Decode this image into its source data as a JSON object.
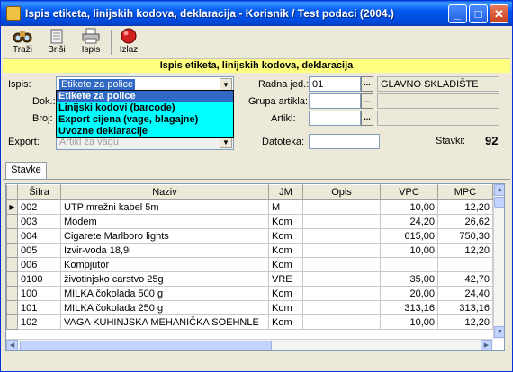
{
  "window": {
    "title": "Ispis etiketa, linijskih kodova, deklaracija - Korisnik / Test podaci (2004.)",
    "minimize_glyph": "_",
    "maximize_glyph": "□",
    "close_glyph": "✕"
  },
  "toolbar": {
    "items": [
      {
        "label": "Traži",
        "icon": "search-binoculars-icon"
      },
      {
        "label": "Briši",
        "icon": "delete-icon"
      },
      {
        "label": "Ispis",
        "icon": "printer-icon"
      },
      {
        "label": "Izlaz",
        "icon": "exit-icon"
      }
    ]
  },
  "banner": "Ispis etiketa, linijskih kodova, deklaracija",
  "form": {
    "ispis_label": "Ispis:",
    "ispis_value": "Etikete za police",
    "dok_label": "Dok.:",
    "broj_label": "Broj:",
    "export_label": "Export:",
    "export_value": "Artikl za vagu",
    "radna_label": "Radna jed.:",
    "radna_value": "01",
    "radna_name": "GLAVNO SKLADIŠTE",
    "grupa_label": "Grupa artikla:",
    "artikl_label": "Artikl:",
    "datoteka_label": "Datoteka:",
    "stavki_label": "Stavki:",
    "stavki_value": "92",
    "ellipsis": "..."
  },
  "dropdown": {
    "options": [
      "Etikete za police",
      "Linijski kodovi (barcode)",
      "Export cijena (vage, blagajne)",
      "Uvozne deklaracije"
    ],
    "selected_index": 0
  },
  "tabs": [
    {
      "label": "Stavke"
    }
  ],
  "grid": {
    "columns": [
      "Šifra",
      "Naziv",
      "JM",
      "Opis",
      "VPC",
      "MPC"
    ],
    "current_row_marker": "▶",
    "rows": [
      [
        "002",
        "UTP mrežni kabel 5m",
        "M",
        "",
        "10,00",
        "12,20"
      ],
      [
        "003",
        "Modem",
        "Kom",
        "",
        "24,20",
        "26,62"
      ],
      [
        "004",
        "Cigarete Marlboro lights",
        "Kom",
        "",
        "615,00",
        "750,30"
      ],
      [
        "005",
        "Izvir-voda 18,9l",
        "Kom",
        "",
        "10,00",
        "12,20"
      ],
      [
        "006",
        "Kompjutor",
        "Kom",
        "",
        "",
        ""
      ],
      [
        "0100",
        "životinjsko carstvo 25g",
        "VRE",
        "",
        "35,00",
        "42,70"
      ],
      [
        "100",
        "MILKA čokolada 500 g",
        "Kom",
        "",
        "20,00",
        "24,40"
      ],
      [
        "101",
        "MILKA čokolada 250 g",
        "Kom",
        "",
        "313,16",
        "313,16"
      ],
      [
        "102",
        "VAGA KUHINJSKA MEHANIČKA SOEHNLE",
        "Kom",
        "",
        "10,00",
        "12,20"
      ]
    ]
  },
  "colors": {
    "banner": "#ffff80",
    "dropdown_bg": "#00ffff",
    "selection": "#316ac5",
    "titlebar": "#0054e3"
  }
}
